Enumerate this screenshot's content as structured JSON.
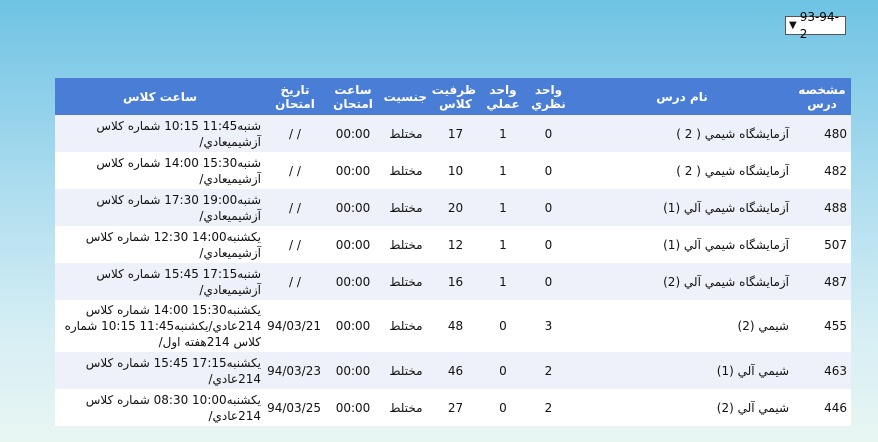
{
  "term": {
    "value": "93-94-2"
  },
  "table": {
    "headers": {
      "code": "مشخصه درس",
      "name": "نام درس",
      "theory": "واحد نظري",
      "practical": "واحد عملي",
      "capacity": "ظرفيت كلاس",
      "gender": "جنسيت",
      "exam_time": "ساعت امتحان",
      "exam_date": "تاريخ امتحان",
      "class_time": "ساعت كلاس"
    },
    "rows": [
      {
        "code": "480",
        "name": "آزمايشگاه شيمي ( 2 )",
        "theory": "0",
        "practical": "1",
        "capacity": "17",
        "gender": "مختلط",
        "exam_time": "00:00",
        "exam_date": "/ /",
        "class_time": "شنبه11:45 10:15 شماره كلاس آزشيميعادي/"
      },
      {
        "code": "482",
        "name": "آزمايشگاه شيمي ( 2 )",
        "theory": "0",
        "practical": "1",
        "capacity": "10",
        "gender": "مختلط",
        "exam_time": "00:00",
        "exam_date": "/ /",
        "class_time": "شنبه15:30 14:00 شماره كلاس آزشيميعادي/"
      },
      {
        "code": "488",
        "name": "آزمايشگاه شيمي آلي (1)",
        "theory": "0",
        "practical": "1",
        "capacity": "20",
        "gender": "مختلط",
        "exam_time": "00:00",
        "exam_date": "/ /",
        "class_time": "شنبه19:00 17:30 شماره كلاس آزشيميعادي/"
      },
      {
        "code": "507",
        "name": "آزمايشگاه شيمي آلي (1)",
        "theory": "0",
        "practical": "1",
        "capacity": "12",
        "gender": "مختلط",
        "exam_time": "00:00",
        "exam_date": "/ /",
        "class_time": "يكشنبه14:00 12:30 شماره كلاس آزشيميعادي/"
      },
      {
        "code": "487",
        "name": "آزمايشگاه شيمي آلي (2)",
        "theory": "0",
        "practical": "1",
        "capacity": "16",
        "gender": "مختلط",
        "exam_time": "00:00",
        "exam_date": "/ /",
        "class_time": "شنبه17:15 15:45 شماره كلاس آزشيميعادي/"
      },
      {
        "code": "455",
        "name": "شيمي (2)",
        "theory": "3",
        "practical": "0",
        "capacity": "48",
        "gender": "مختلط",
        "exam_time": "00:00",
        "exam_date": "94/03/21",
        "class_time": "يكشنبه15:30 14:00 شماره كلاس 214عادي/يكشنبه11:45 10:15 شماره كلاس 214هفته اول/"
      },
      {
        "code": "463",
        "name": "شيمي آلي (1)",
        "theory": "2",
        "practical": "0",
        "capacity": "46",
        "gender": "مختلط",
        "exam_time": "00:00",
        "exam_date": "94/03/23",
        "class_time": "يكشنبه17:15 15:45 شماره كلاس 214عادي/"
      },
      {
        "code": "446",
        "name": "شيمي آلي (2)",
        "theory": "2",
        "practical": "0",
        "capacity": "27",
        "gender": "مختلط",
        "exam_time": "00:00",
        "exam_date": "94/03/25",
        "class_time": "يكشنبه10:00 08:30 شماره كلاس 214عادي/"
      }
    ]
  }
}
